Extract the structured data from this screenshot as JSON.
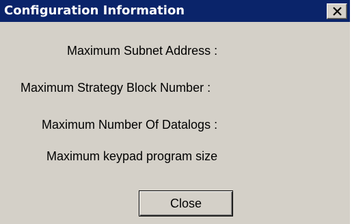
{
  "window": {
    "title": "Configuration Information",
    "close_glyph": "close-icon"
  },
  "fields": [
    {
      "label": "Maximum Subnet Address :"
    },
    {
      "label": "Maximum Strategy Block Number :"
    },
    {
      "label": "Maximum Number Of Datalogs :"
    },
    {
      "label": "Maximum keypad program size"
    }
  ],
  "buttons": {
    "close_label": "Close"
  },
  "colors": {
    "titlebar": "#0a246a",
    "dialog_face": "#d4d0c8",
    "title_text": "#ffffff"
  }
}
